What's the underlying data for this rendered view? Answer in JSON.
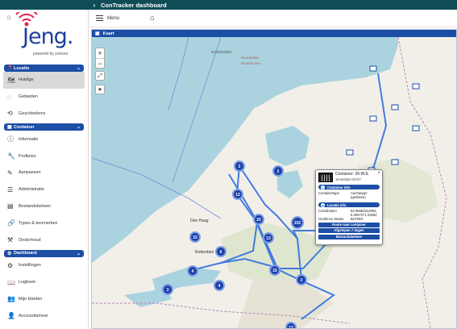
{
  "topbar": {
    "title": "ConTracker dashboard"
  },
  "logo": {
    "corner_letter": "D",
    "brand": "Jeng",
    "brand_dot": ".",
    "powered": "powered by yooseo"
  },
  "header": {
    "menu_label": "Menu"
  },
  "sidebar": {
    "sections": [
      {
        "title": "Locatie",
        "items": [
          {
            "label": "Huidige",
            "icon": "map-icon",
            "active": true
          },
          {
            "label": "Gebieden",
            "icon": "dashed-circle-icon"
          },
          {
            "label": "Geschiedenis",
            "icon": "history-icon"
          }
        ]
      },
      {
        "title": "Container",
        "items": [
          {
            "label": "Informatie",
            "icon": "info-icon"
          },
          {
            "label": "Profielen",
            "icon": "wrench-icon"
          },
          {
            "label": "Aanpassen",
            "icon": "pencil-icon"
          },
          {
            "label": "Administratie",
            "icon": "list-icon"
          },
          {
            "label": "Bestandsbeheer",
            "icon": "container-icon"
          },
          {
            "label": "Types & kenmerken",
            "icon": "link-icon"
          },
          {
            "label": "Onderhoud",
            "icon": "tools-icon"
          }
        ]
      },
      {
        "title": "Dashboard",
        "items": [
          {
            "label": "Instellingen",
            "icon": "sliders-icon"
          },
          {
            "label": "Logboek",
            "icon": "book-icon"
          },
          {
            "label": "Mijn klanten",
            "icon": "users-icon"
          },
          {
            "label": "Accountbeheer",
            "icon": "user-gear-icon"
          }
        ]
      }
    ]
  },
  "map": {
    "panel_title": "Kaart",
    "zoom_in": "+",
    "zoom_out": "−",
    "labels": {
      "noordzee": "NOORDZEE",
      "noord": "Noordelijke",
      "waddenzee": "Waddenzee",
      "den_haag": "Den Haag",
      "rotterdam": "Rotterdam"
    },
    "clusters": [
      "2",
      "2",
      "13",
      "25",
      "102",
      "13",
      "15",
      "6",
      "4",
      "15",
      "2",
      "4",
      "3",
      "13"
    ],
    "popup": {
      "title": "Container: 26-WJL",
      "date": "18-oktober 06:07",
      "close": "×",
      "info_header": "Container info",
      "type_key": "Containertype",
      "type_val": "Aanhanger (gesloten)",
      "loc_header": "Locatie info",
      "coord_key": "Coördinaten",
      "coord_val": "52.90653312993, 6.3087271 03662",
      "geofence_key": "Geofence Status",
      "geofence_val": "BUITEN",
      "btn_route": "Route naar container",
      "btn_afgelopen": "Afgelopen 7 dagen",
      "btn_beheer": "Bestandsbeheer"
    }
  },
  "colors": {
    "topbar": "#0f4c56",
    "accent": "#1c4ea6",
    "water": "#aad3df",
    "land": "#f2efe9",
    "route": "#2f6fe0"
  }
}
